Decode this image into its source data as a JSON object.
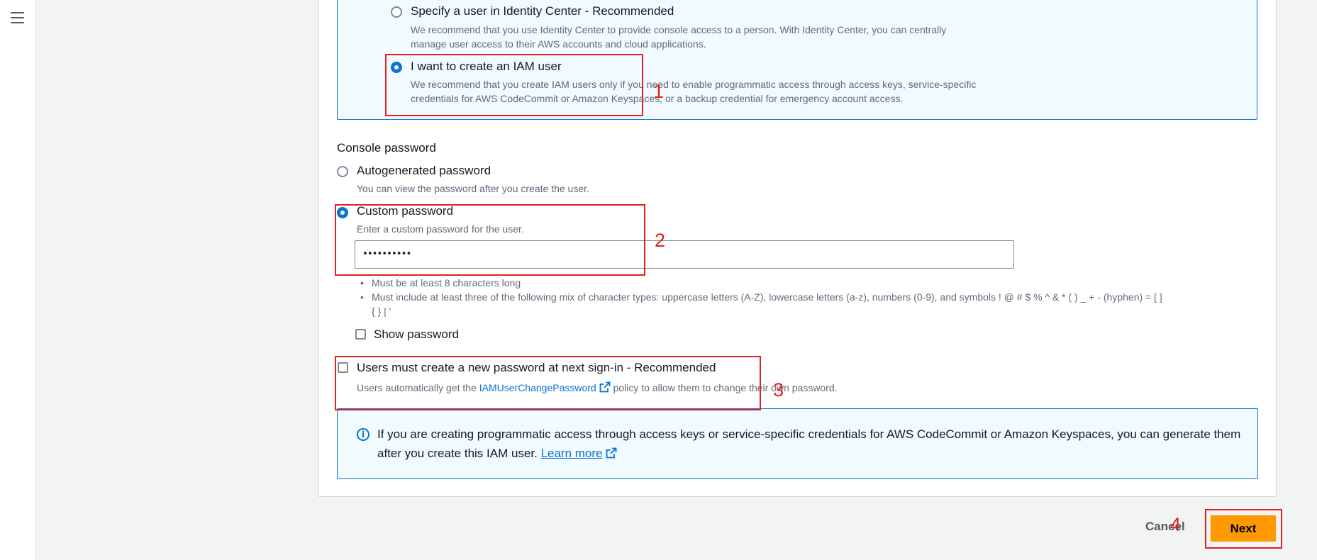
{
  "nav": {
    "menu_icon": "hamburger-menu-icon"
  },
  "user_access": {
    "option_identity_center": {
      "label": "Specify a user in Identity Center - Recommended",
      "desc_line1": "We recommend that you use Identity Center to provide console access to a person. With Identity Center, you can centrally",
      "desc_line2": "manage user access to their AWS accounts and cloud applications.",
      "selected": false
    },
    "option_iam_user": {
      "label": "I want to create an IAM user",
      "desc_line1": "We recommend that you create IAM users only if you need to enable programmatic access through access keys, service-specific",
      "desc_line2": "credentials for AWS CodeCommit or Amazon Keyspaces, or a backup credential for emergency account access.",
      "selected": true
    }
  },
  "console_password": {
    "title": "Console password",
    "autogenerated": {
      "label": "Autogenerated password",
      "desc": "You can view the password after you create the user.",
      "selected": false
    },
    "custom": {
      "label": "Custom password",
      "desc": "Enter a custom password for the user.",
      "selected": true,
      "value": "••••••••••"
    },
    "rules": [
      "Must be at least 8 characters long",
      "Must include at least three of the following mix of character types: uppercase letters (A-Z), lowercase letters (a-z), numbers (0-9), and symbols ! @ # $ % ^ & * ( ) _ + - (hyphen) = [ ]",
      "{ } | '"
    ],
    "show_password": {
      "label": "Show password",
      "checked": false
    }
  },
  "reset_requirement": {
    "label": "Users must create a new password at next sign-in - Recommended",
    "checked": false,
    "desc_prefix": "Users automatically get the",
    "policy_link": "IAMUserChangePassword",
    "desc_suffix": "policy to allow them to change their own password."
  },
  "info_alert": {
    "text": "If you are creating programmatic access through access keys or service-specific credentials for AWS CodeCommit or Amazon Keyspaces, you can generate them after you create this IAM user.",
    "link": "Learn more"
  },
  "footer": {
    "cancel_label": "Cancel",
    "next_label": "Next"
  },
  "annotations": [
    "1",
    "2",
    "3",
    "4"
  ],
  "colors": {
    "accent": "#0972d3",
    "primary_button": "#ff9900",
    "annotation": "#e02020"
  }
}
